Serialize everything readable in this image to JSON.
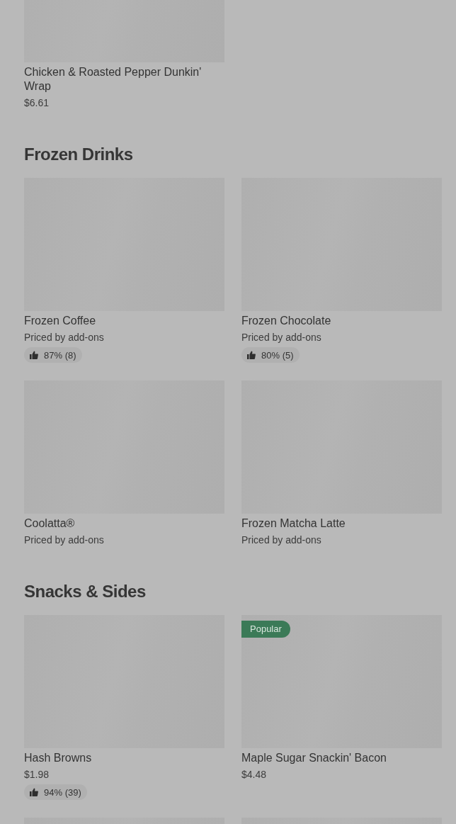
{
  "sections": [
    {
      "items": [
        {
          "kind": "product",
          "name": "Chicken & Roasted Pepper Dunkin' Wrap",
          "detail": "$6.61"
        }
      ]
    },
    {
      "heading": "Frozen Drinks",
      "items": [
        {
          "kind": "product",
          "name": "Frozen Coffee",
          "detail": "Priced by add-ons",
          "rating": "87% (8)"
        },
        {
          "kind": "product",
          "name": "Frozen Chocolate",
          "detail": "Priced by add-ons",
          "rating": "80% (5)"
        },
        {
          "kind": "product",
          "name": "Coolatta®",
          "detail": "Priced by add-ons"
        },
        {
          "kind": "product",
          "name": "Frozen Matcha Latte",
          "detail": "Priced by add-ons"
        }
      ]
    },
    {
      "heading": "Snacks & Sides",
      "items": [
        {
          "kind": "product",
          "name": "Hash Browns",
          "detail": "$1.98",
          "rating": "94% (39)"
        },
        {
          "kind": "product",
          "name": "Maple Sugar Snackin' Bacon",
          "detail": "$4.48",
          "badge": "Popular"
        },
        {
          "kind": "image_only"
        },
        {
          "kind": "image_only"
        }
      ]
    }
  ]
}
